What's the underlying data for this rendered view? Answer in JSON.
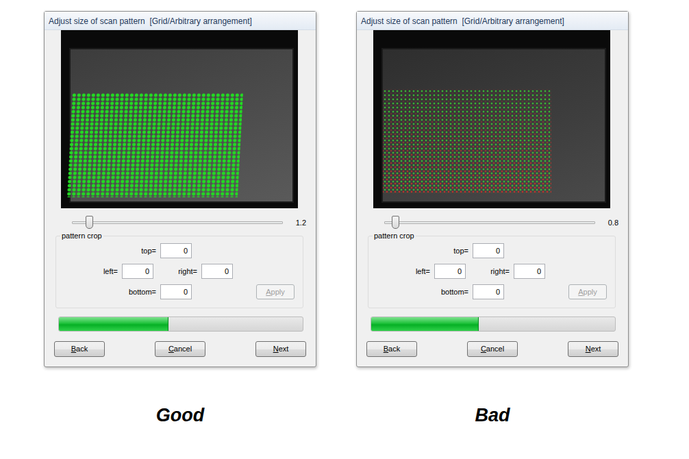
{
  "panels": [
    {
      "kind": "good",
      "window": {
        "title": "Adjust size of scan pattern  [Grid/Arbitrary arrangement]"
      },
      "slider": {
        "level": 0.08,
        "reading": "1.2"
      },
      "crop": {
        "title": "pattern crop",
        "fields": [
          {
            "label": "top=",
            "value": "0"
          },
          {
            "label": "left=",
            "value": "0"
          },
          {
            "label": "right=",
            "value": "0"
          },
          {
            "label": "bottom=",
            "value": "0"
          }
        ],
        "apply": {
          "label": "Apply",
          "disabled": true
        }
      },
      "progress": {
        "level": 0.45
      },
      "buttons": [
        "Back",
        "Cancel",
        "Next"
      ],
      "caption": "Good"
    },
    {
      "kind": "bad",
      "window": {
        "title": "Adjust size of scan pattern  [Grid/Arbitrary arrangement]"
      },
      "slider": {
        "level": 0.05,
        "reading": "0.8"
      },
      "crop": {
        "title": "pattern crop",
        "fields": [
          {
            "label": "top=",
            "value": "0"
          },
          {
            "label": "left=",
            "value": "0"
          },
          {
            "label": "right=",
            "value": "0"
          },
          {
            "label": "bottom=",
            "value": "0"
          }
        ],
        "apply": {
          "label": "Apply",
          "disabled": true
        }
      },
      "progress": {
        "level": 0.44
      },
      "buttons": [
        "Back",
        "Cancel",
        "Next"
      ],
      "caption": "Bad"
    }
  ]
}
